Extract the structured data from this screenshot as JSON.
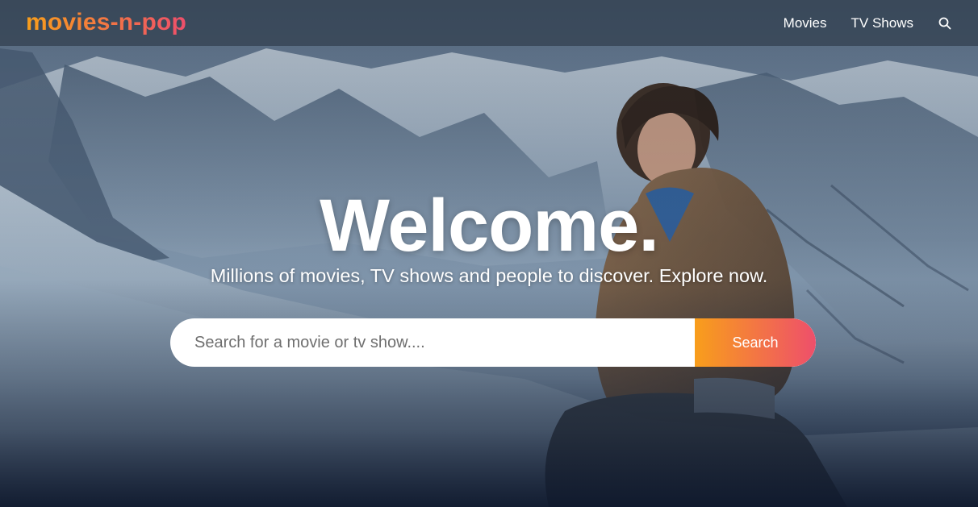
{
  "header": {
    "logo": "movies-n-pop",
    "nav": [
      {
        "label": "Movies"
      },
      {
        "label": "TV Shows"
      }
    ],
    "search_icon": "search-icon"
  },
  "hero": {
    "title": "Welcome.",
    "subtitle": "Millions of movies, TV shows and people to discover. Explore now.",
    "search": {
      "placeholder": "Search for a movie or tv show....",
      "value": "",
      "button_label": "Search"
    },
    "background": "hero-backdrop-image"
  },
  "colors": {
    "gradient_start": "#f89e1b",
    "gradient_end": "#ee4f6b",
    "header_bg": "#303e4e",
    "hero_bottom": "#0e182c"
  }
}
